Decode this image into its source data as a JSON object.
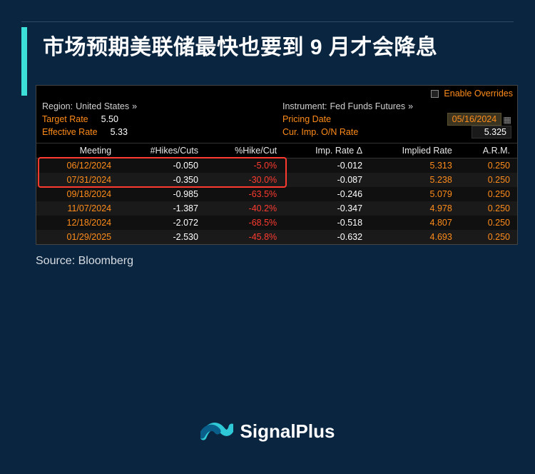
{
  "title": "市场预期美联储最快也要到 9 月才会降息",
  "terminal": {
    "enable_overrides": "Enable Overrides",
    "region_label": "Region:",
    "region_value": "United States",
    "instrument_label": "Instrument:",
    "instrument_value": "Fed Funds Futures",
    "target_rate_label": "Target Rate",
    "target_rate_value": "5.50",
    "effective_rate_label": "Effective Rate",
    "effective_rate_value": "5.33",
    "pricing_date_label": "Pricing Date",
    "pricing_date_value": "05/16/2024",
    "cur_imp_label": "Cur. Imp. O/N Rate",
    "cur_imp_value": "5.325",
    "columns": [
      "Meeting",
      "#Hikes/Cuts",
      "%Hike/Cut",
      "Imp. Rate Δ",
      "Implied Rate",
      "A.R.M."
    ],
    "rows": [
      {
        "meeting": "06/12/2024",
        "hikes": "-0.050",
        "pct": "-5.0%",
        "delta": "-0.012",
        "implied": "5.313",
        "arm": "0.250",
        "hl": true
      },
      {
        "meeting": "07/31/2024",
        "hikes": "-0.350",
        "pct": "-30.0%",
        "delta": "-0.087",
        "implied": "5.238",
        "arm": "0.250",
        "hl": true
      },
      {
        "meeting": "09/18/2024",
        "hikes": "-0.985",
        "pct": "-63.5%",
        "delta": "-0.246",
        "implied": "5.079",
        "arm": "0.250",
        "hl": false
      },
      {
        "meeting": "11/07/2024",
        "hikes": "-1.387",
        "pct": "-40.2%",
        "delta": "-0.347",
        "implied": "4.978",
        "arm": "0.250",
        "hl": false
      },
      {
        "meeting": "12/18/2024",
        "hikes": "-2.072",
        "pct": "-68.5%",
        "delta": "-0.518",
        "implied": "4.807",
        "arm": "0.250",
        "hl": false
      },
      {
        "meeting": "01/29/2025",
        "hikes": "-2.530",
        "pct": "-45.8%",
        "delta": "-0.632",
        "implied": "4.693",
        "arm": "0.250",
        "hl": false
      }
    ]
  },
  "source": "Source: Bloomberg",
  "brand": "SignalPlus"
}
